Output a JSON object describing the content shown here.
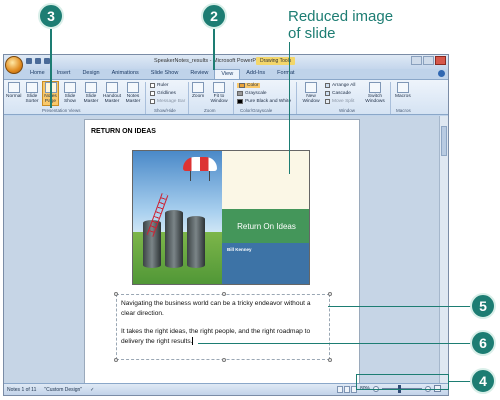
{
  "callouts": {
    "c3": "3",
    "c2": "2",
    "c5": "5",
    "c6": "6",
    "c4": "4"
  },
  "caption": "Reduced image of slide",
  "window": {
    "title": "SpeakerNotes_results - Microsoft PowerPoint",
    "context_tool": "Drawing Tools"
  },
  "tabs": [
    "Home",
    "Insert",
    "Design",
    "Animations",
    "Slide Show",
    "Review",
    "View",
    "Add-Ins",
    "Format"
  ],
  "ribbon": {
    "normal": "Normal",
    "slide_sorter": "Slide Sorter",
    "notes_page": "Notes Page",
    "slide_show": "Slide Show",
    "slide_master": "Slide Master",
    "handout_master": "Handout Master",
    "notes_master": "Notes Master",
    "ruler": "Ruler",
    "gridlines": "Gridlines",
    "message_bar": "Message Bar",
    "zoom": "Zoom",
    "fit_to_window": "Fit to Window",
    "color": "Color",
    "grayscale": "Grayscale",
    "pure_bw": "Pure Black and White",
    "new_window": "New Window",
    "arrange_all": "Arrange All",
    "cascade": "Cascade",
    "move_split": "Move Split",
    "switch_windows": "Switch Windows",
    "macros": "Macros",
    "groups": {
      "presentation_views": "Presentation Views",
      "show_hide": "Show/Hide",
      "zoom": "Zoom",
      "color_grayscale": "Color/Grayscale",
      "window": "Window",
      "macros": "Macros"
    }
  },
  "page": {
    "title": "RETURN ON IDEAS",
    "slide_heading": "Return On Ideas",
    "slide_author": "Bill Kenney",
    "notes_p1": "Navigating the business world can be a tricky endeavor without a clear direction.",
    "notes_p2": "It takes the right ideas, the right people, and the right roadmap to delivery the right results."
  },
  "status": {
    "slide_of": "Notes 1 of 11",
    "theme": "\"Custom Design\"",
    "zoom": "80%"
  },
  "colors": {
    "callout": "#1d7d73",
    "ribbon": "#d5e3f3",
    "selected": "#f9c86a"
  }
}
